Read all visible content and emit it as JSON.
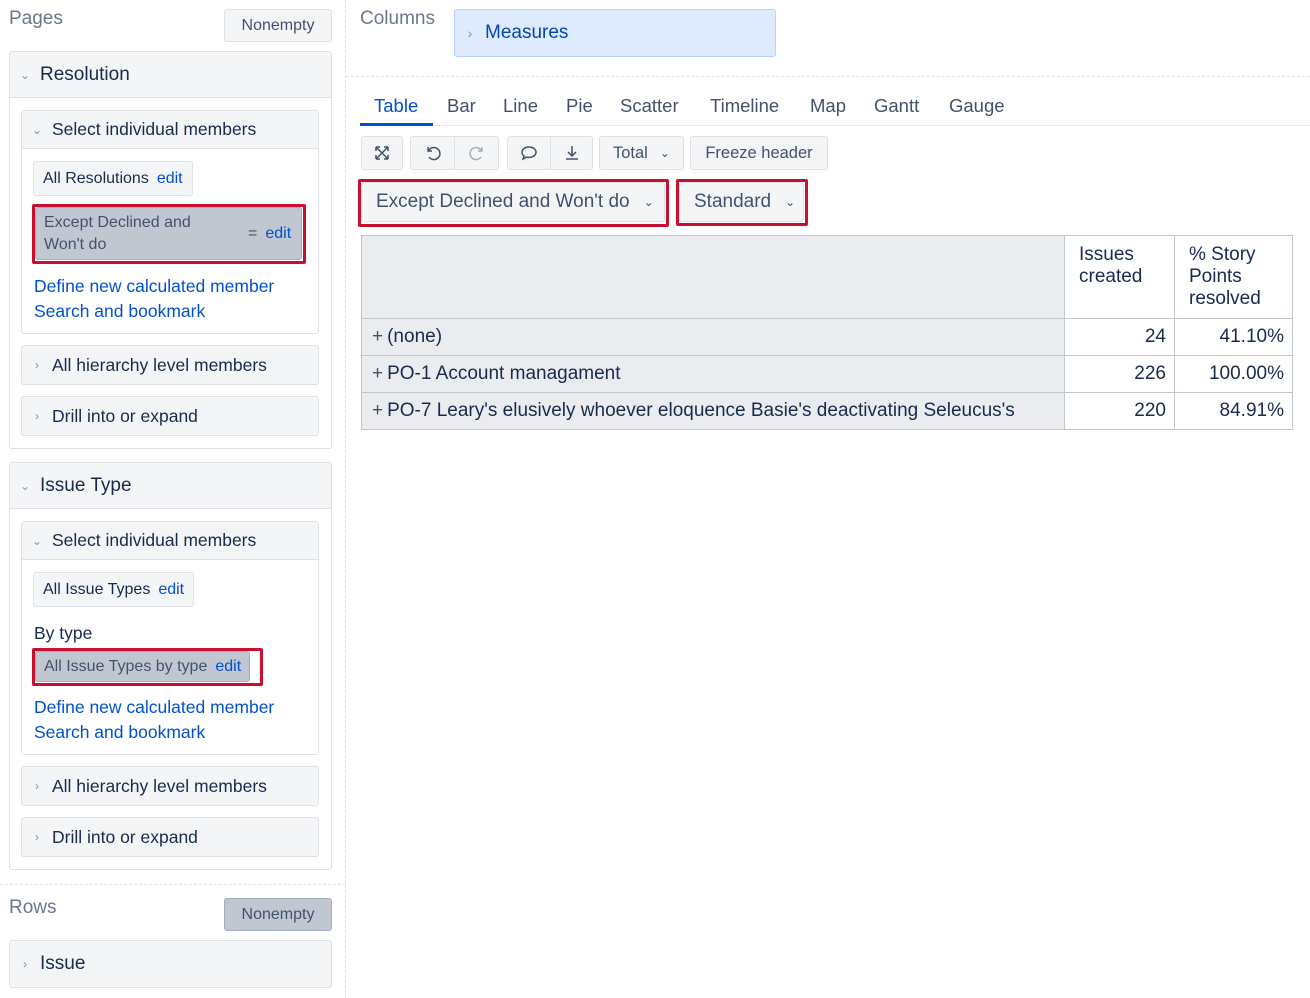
{
  "pages": {
    "title": "Pages",
    "nonempty_label": "Nonempty",
    "resolution": {
      "title": "Resolution",
      "select_title": "Select individual members",
      "all_chip": "All Resolutions",
      "all_chip_edit": "edit",
      "selected_chip": "Except Declined and Won't do",
      "selected_chip_eq": "=",
      "selected_chip_edit": "edit",
      "define_link": "Define new calculated member",
      "search_link": "Search and bookmark",
      "hierarchy_label": "All hierarchy level members",
      "drill_label": "Drill into or expand"
    },
    "issue_type": {
      "title": "Issue Type",
      "select_title": "Select individual members",
      "all_chip": "All Issue Types",
      "all_chip_edit": "edit",
      "by_type_label": "By type",
      "selected_chip": "All Issue Types by type",
      "selected_chip_edit": "edit",
      "define_link": "Define new calculated member",
      "search_link": "Search and bookmark",
      "hierarchy_label": "All hierarchy level members",
      "drill_label": "Drill into or expand"
    }
  },
  "rows": {
    "title": "Rows",
    "nonempty_label": "Nonempty",
    "issue_label": "Issue"
  },
  "columns": {
    "title": "Columns",
    "measures_label": "Measures"
  },
  "tabs": [
    "Table",
    "Bar",
    "Line",
    "Pie",
    "Scatter",
    "Timeline",
    "Map",
    "Gantt",
    "Gauge"
  ],
  "active_tab": "Table",
  "toolbar": {
    "total_label": "Total",
    "freeze_label": "Freeze header",
    "icons": [
      "expand-icon",
      "undo-icon",
      "redo-icon",
      "comment-icon",
      "download-icon"
    ]
  },
  "dropdowns": {
    "filter": "Except Declined and Won't do",
    "view": "Standard"
  },
  "table": {
    "headers": [
      "Issues created",
      "% Story Points resolved"
    ],
    "rows": [
      {
        "name": "(none)",
        "issues_created": "24",
        "sp_resolved": "41.10%"
      },
      {
        "name": "PO-1 Account managament",
        "issues_created": "226",
        "sp_resolved": "100.00%"
      },
      {
        "name": "PO-7 Leary's elusively whoever eloquence Basie's deactivating Seleucus's",
        "issues_created": "220",
        "sp_resolved": "84.91%"
      }
    ]
  },
  "colors": {
    "highlight": "#c8102e",
    "link": "#0052cc",
    "measures_bg": "#deebff"
  }
}
